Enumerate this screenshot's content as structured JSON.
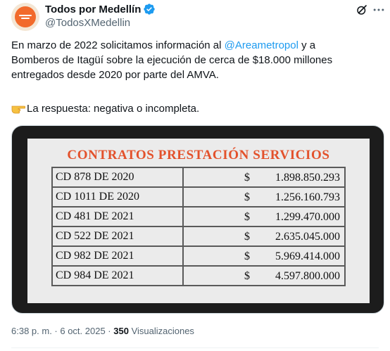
{
  "author": {
    "display_name": "Todos por Medellín",
    "handle": "@TodosXMedellin"
  },
  "tweet": {
    "text_before_mention": "En marzo de 2022 solicitamos información al ",
    "mention": "@Areametropol",
    "text_after_mention": " y a Bomberos de Itagüí sobre la ejecución de cerca de $18.000 millones entregados desde 2020 por parte del AMVA.",
    "reply_text": "La respuesta: negativa o incompleta."
  },
  "image": {
    "title": "CONTRATOS PRESTACIÓN SERVICIOS",
    "rows": [
      {
        "code": "CD 878 DE 2020",
        "currency": "$",
        "amount": "1.898.850.293"
      },
      {
        "code": "CD 1011 DE 2020",
        "currency": "$",
        "amount": "1.256.160.793"
      },
      {
        "code": "CD 481 DE 2021",
        "currency": "$",
        "amount": "1.299.470.000"
      },
      {
        "code": "CD 522 DE 2021",
        "currency": "$",
        "amount": "2.635.045.000"
      },
      {
        "code": "CD 982 DE 2021",
        "currency": "$",
        "amount": "5.969.414.000"
      },
      {
        "code": "CD 984 DE 2021",
        "currency": "$",
        "amount": "4.597.800.000"
      }
    ]
  },
  "footer": {
    "timestamp": "6:38 p. m. · 6 oct. 2025 · ",
    "views_count": "350",
    "views_label": " Visualizaciones"
  },
  "icons": {
    "verified": "verified-badge-icon",
    "grok": "grok-icon",
    "more": "more-options-icon",
    "hand": "pointing-hand-emoji"
  },
  "colors": {
    "accent": "#1d9bf0",
    "title_orange": "#e3512b",
    "avatar_orange": "#f26a2b"
  }
}
